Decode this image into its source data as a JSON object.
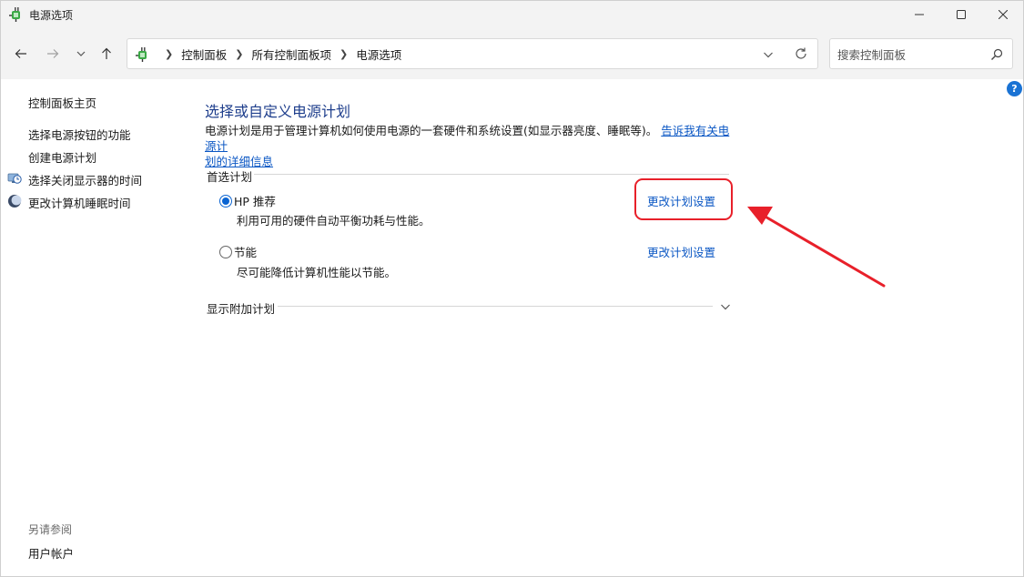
{
  "window": {
    "title": "电源选项",
    "buttons": {
      "minimize": "minimize",
      "maximize": "maximize",
      "close": "close"
    }
  },
  "nav": {
    "breadcrumbs": [
      "控制面板",
      "所有控制面板项",
      "电源选项"
    ],
    "search_placeholder": "搜索控制面板"
  },
  "help": {
    "label": "?"
  },
  "sidebar": {
    "items": [
      {
        "label": "控制面板主页",
        "icon": null
      },
      {
        "label": "选择电源按钮的功能",
        "icon": null
      },
      {
        "label": "创建电源计划",
        "icon": null
      },
      {
        "label": "选择关闭显示器的时间",
        "icon": "monitor-clock-icon"
      },
      {
        "label": "更改计算机睡眠时间",
        "icon": "moon-icon"
      }
    ],
    "see_also_label": "另请参阅",
    "see_also_items": [
      "用户帐户"
    ]
  },
  "main": {
    "title": "选择或自定义电源计划",
    "description_text": "电源计划是用于管理计算机如何使用电源的一套硬件和系统设置(如显示器亮度、睡眠等)。",
    "description_link_line1": "告诉我有关电源计",
    "description_link_line2": "划的详细信息",
    "preferred_label": "首选计划",
    "plans": [
      {
        "name": "HP 推荐",
        "description": "利用可用的硬件自动平衡功耗与性能。",
        "link": "更改计划设置",
        "selected": true
      },
      {
        "name": "节能",
        "description": "尽可能降低计算机性能以节能。",
        "link": "更改计划设置",
        "selected": false
      }
    ],
    "additional_label": "显示附加计划"
  },
  "colors": {
    "accent": "#0a64d2",
    "link": "#0b57c4",
    "title": "#1e3e8c",
    "annotation": "#e8202a"
  }
}
